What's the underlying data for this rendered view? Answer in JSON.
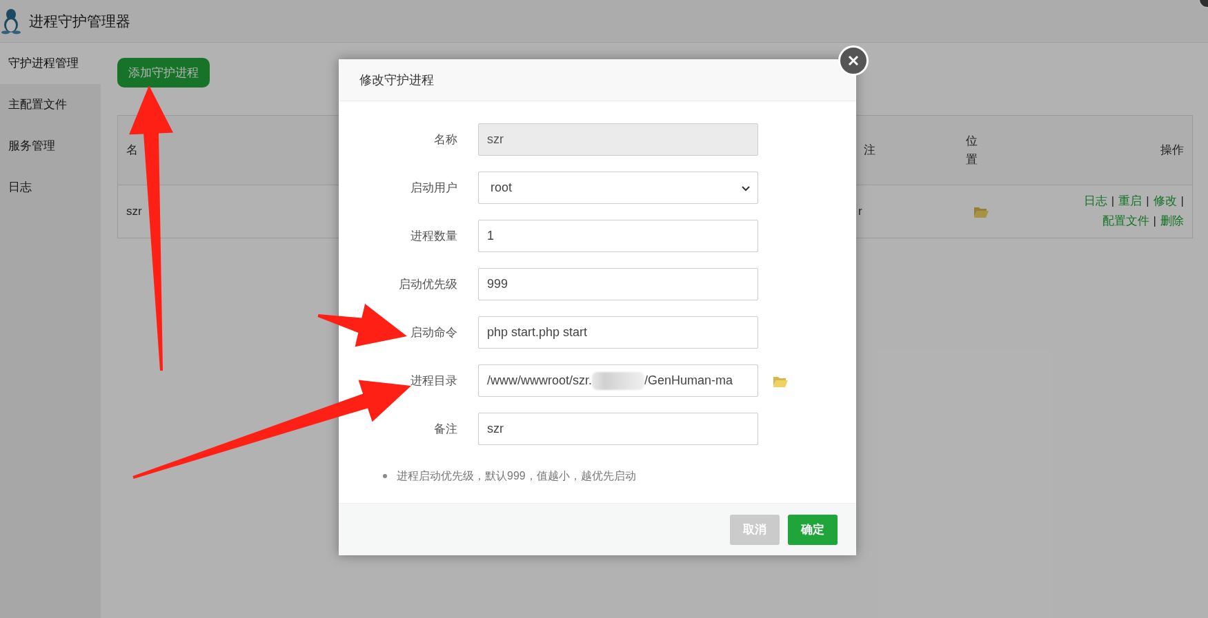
{
  "app": {
    "title": "进程守护管理器"
  },
  "sidebar": {
    "items": [
      {
        "label": "守护进程管理",
        "selected": true
      },
      {
        "label": "主配置文件",
        "selected": false
      },
      {
        "label": "服务管理",
        "selected": false
      },
      {
        "label": "日志",
        "selected": false
      }
    ]
  },
  "toolbar": {
    "add_button": "添加守护进程"
  },
  "table": {
    "columns": [
      {
        "label": "名"
      },
      {
        "label": "注"
      },
      {
        "label": "位置"
      },
      {
        "label": "操作"
      }
    ],
    "rows": [
      {
        "name": "szr",
        "note": "r",
        "separator": "|",
        "actions": [
          "日志",
          "重启",
          "修改",
          "配置文件",
          "删除"
        ]
      }
    ]
  },
  "overlay": {
    "dimmed": true
  },
  "dialog": {
    "title": "修改守护进程",
    "fields": [
      {
        "label": "名称",
        "kind": "text",
        "value": "szr",
        "disabled": true
      },
      {
        "label": "启动用户",
        "kind": "select",
        "value": "root",
        "disabled": false
      },
      {
        "label": "进程数量",
        "kind": "text",
        "value": "1",
        "disabled": false
      },
      {
        "label": "启动优先级",
        "kind": "text",
        "value": "999",
        "disabled": false
      },
      {
        "label": "启动命令",
        "kind": "text",
        "value": "php start.php start",
        "disabled": false
      },
      {
        "label": "进程目录",
        "kind": "path",
        "value": "/www/wwwroot/szr.",
        "value_after_redaction": "/GenHuman-ma",
        "disabled": false
      },
      {
        "label": "备注",
        "kind": "text",
        "value": "szr",
        "disabled": false
      }
    ],
    "hints": [
      "进程启动优先级，默认999，值越小，越优先启动"
    ],
    "buttons": [
      {
        "label": "取消",
        "kind": "cancel"
      },
      {
        "label": "确定",
        "kind": "confirm"
      }
    ]
  },
  "annotations": [
    {
      "kind": "arrow",
      "color": "#ff2015"
    },
    {
      "kind": "arrow",
      "color": "#ff2015"
    },
    {
      "kind": "arrow",
      "color": "#ff2015"
    }
  ]
}
